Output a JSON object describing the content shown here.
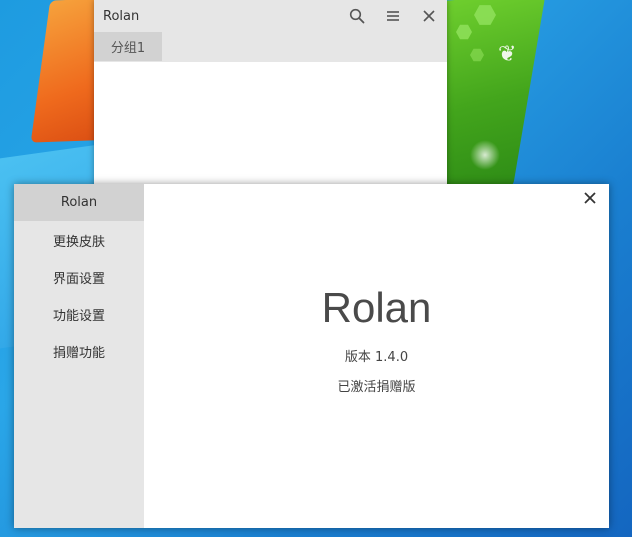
{
  "desktop": {
    "accent": "#1e9be0"
  },
  "back_window": {
    "title": "Rolan",
    "tabs": [
      {
        "label": "分组1"
      }
    ],
    "icons": [
      "search-icon",
      "menu-icon",
      "close-icon"
    ]
  },
  "about_window": {
    "sidebar": {
      "items": [
        {
          "label": "Rolan",
          "active": true
        },
        {
          "label": "更换皮肤"
        },
        {
          "label": "界面设置"
        },
        {
          "label": "功能设置"
        },
        {
          "label": "捐赠功能"
        }
      ]
    },
    "main": {
      "app_name": "Rolan",
      "version": "版本 1.4.0",
      "license": "已激活捐赠版"
    },
    "close_icon": "close-icon"
  },
  "colors": {
    "titlebar": "#e6e6e6",
    "active_tab": "#d2d2d2",
    "text": "#333333"
  }
}
